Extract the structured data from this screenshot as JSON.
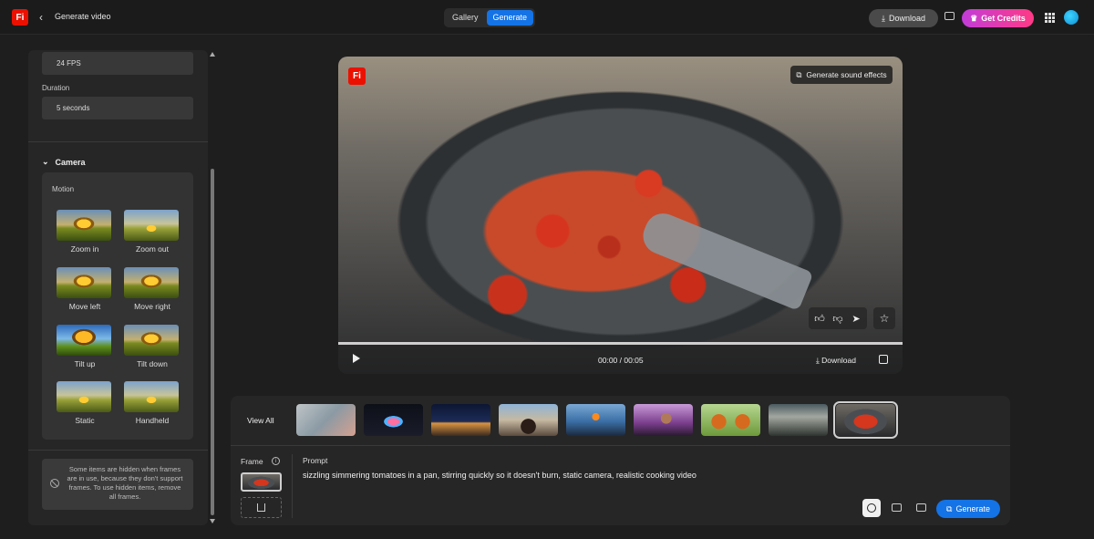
{
  "header": {
    "logo": "Fi",
    "back": "‹",
    "title": "Generate video",
    "tabs": [
      {
        "label": "Gallery",
        "active": false
      },
      {
        "label": "Generate",
        "active": true
      }
    ],
    "download_label": "Download",
    "credits_label": "Get Credits",
    "accent_color": "#1473e6",
    "credits_gradient": [
      "#c13cd9",
      "#ff3a85"
    ]
  },
  "sidebar": {
    "fps_value": "24 FPS",
    "duration_label": "Duration",
    "duration_value": "5 seconds",
    "camera_label": "Camera",
    "motion_label": "Motion",
    "motions": [
      {
        "label": "Zoom in"
      },
      {
        "label": "Zoom out"
      },
      {
        "label": "Move left"
      },
      {
        "label": "Move right"
      },
      {
        "label": "Tilt up"
      },
      {
        "label": "Tilt down"
      },
      {
        "label": "Static"
      },
      {
        "label": "Handheld"
      }
    ],
    "notice": "Some items are hidden when frames are in use, because they don't support frames. To use hidden items, remove all frames."
  },
  "player": {
    "logo": "Fi",
    "sound_effects_label": "Generate sound effects",
    "time": "00:00 / 00:05",
    "download_label": "Download",
    "rating_icons": [
      "thumbs-up-icon",
      "thumbs-down-icon",
      "send-icon",
      "star-icon"
    ]
  },
  "gallery": {
    "view_all_label": "View All",
    "thumbnails": [
      {
        "name": "thumb-1"
      },
      {
        "name": "thumb-2"
      },
      {
        "name": "thumb-3"
      },
      {
        "name": "thumb-4"
      },
      {
        "name": "thumb-5"
      },
      {
        "name": "thumb-6"
      },
      {
        "name": "thumb-7"
      },
      {
        "name": "thumb-8"
      },
      {
        "name": "thumb-9",
        "selected": true
      }
    ]
  },
  "prompt_area": {
    "frame_label": "Frame",
    "prompt_label": "Prompt",
    "prompt_text": "sizzling simmering tomatoes in a pan, stirring quickly so it doesn't burn, static camera, realistic cooking video",
    "generate_label": "Generate"
  }
}
